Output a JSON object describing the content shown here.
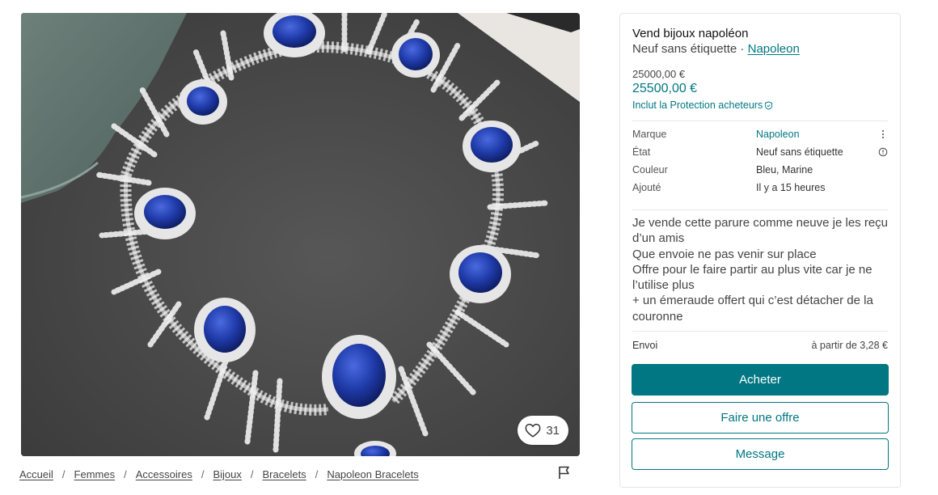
{
  "item": {
    "title": "Vend bijoux napoléon",
    "condition": "Neuf sans étiquette",
    "separator": "·",
    "brand_link": "Napoleon",
    "price_original": "25000,00 €",
    "price_total": "25500,00 €",
    "protection_text": "Inclut la Protection acheteurs",
    "favorites_count": "31"
  },
  "details": [
    {
      "label": "Marque",
      "value": "Napoleon",
      "icon": "more-vertical-icon"
    },
    {
      "label": "État",
      "value": "Neuf sans étiquette",
      "icon": "info-icon"
    },
    {
      "label": "Couleur",
      "value": "Bleu, Marine",
      "icon": ""
    },
    {
      "label": "Ajouté",
      "value": "Il y a 15 heures",
      "icon": ""
    }
  ],
  "description": "Je vende cette parure comme neuve je les reçu d’un amis\nQue envoie ne pas venir sur place\nOffre pour le faire partir au plus vite car je ne l’utilise plus\n+ un émeraude offert qui c’est détacher de la couronne",
  "shipping": {
    "label": "Envoi",
    "value": "à partir de 3,28 €"
  },
  "actions": {
    "buy": "Acheter",
    "offer": "Faire une offre",
    "message": "Message"
  },
  "breadcrumb": [
    "Accueil",
    "Femmes",
    "Accessoires",
    "Bijoux",
    "Bracelets",
    "Napoleon Bracelets"
  ],
  "breadcrumb_separator": "/",
  "colors": {
    "accent": "#007782",
    "text": "#111111",
    "muted": "#444444",
    "sapphire": "#1f3aa8"
  },
  "icons": {
    "favorite": "heart-icon",
    "report": "flag-icon",
    "protection": "shield-check-icon"
  }
}
